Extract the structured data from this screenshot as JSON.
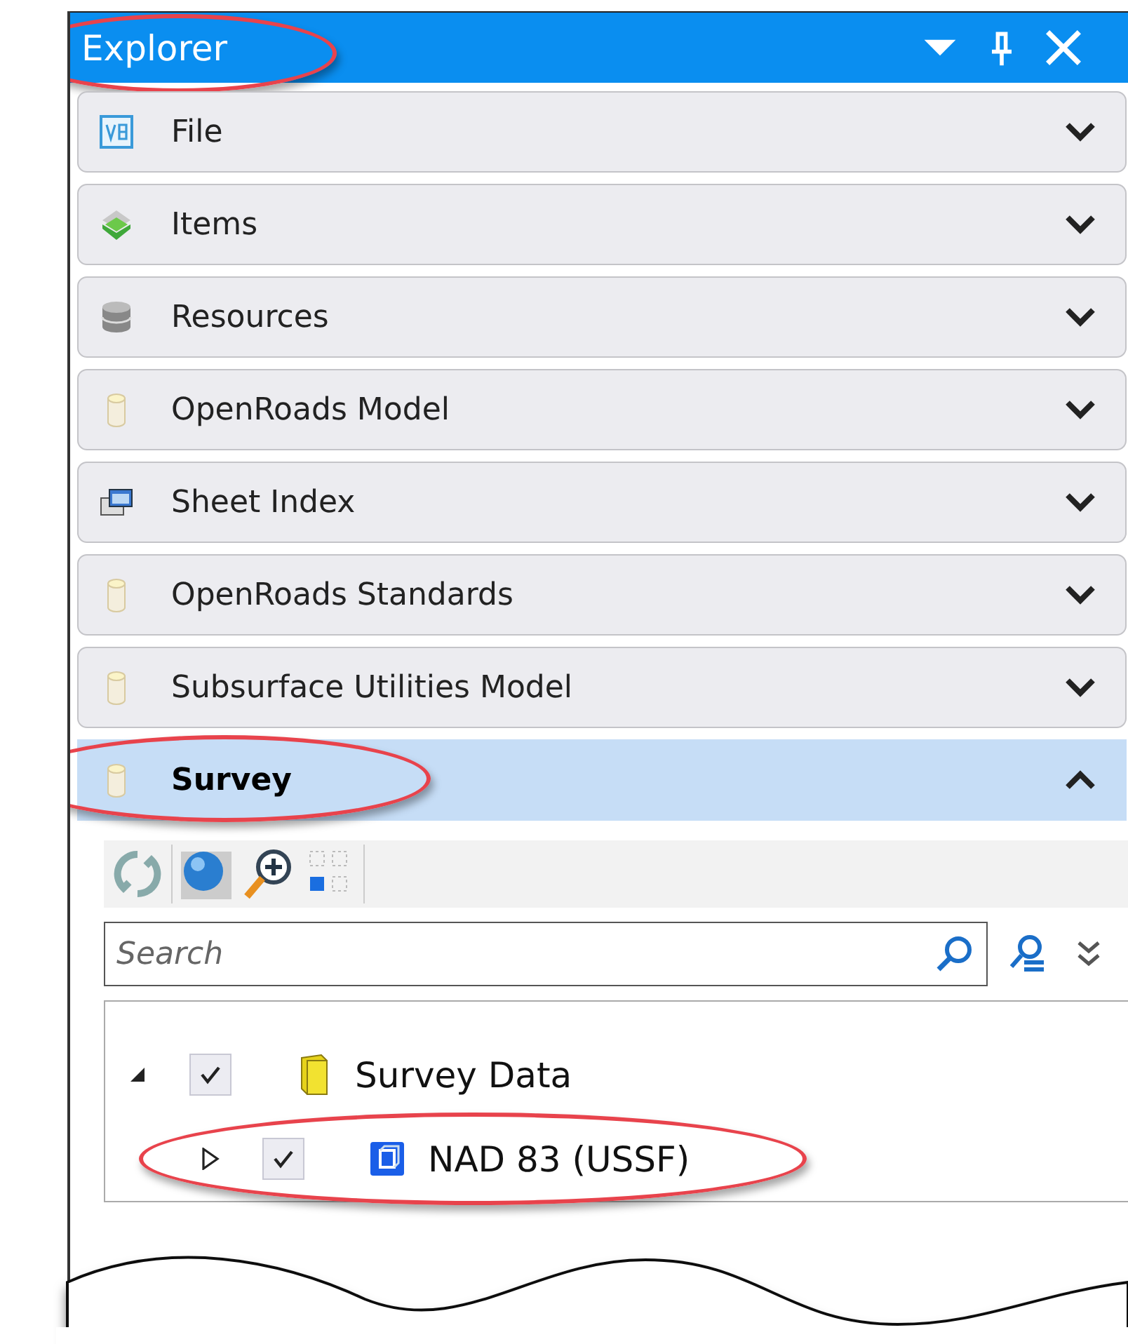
{
  "panel": {
    "title": "Explorer",
    "callout": true
  },
  "sections": [
    {
      "label": "File",
      "kind": "v8",
      "expanded": false,
      "callout": false
    },
    {
      "label": "Items",
      "kind": "layers",
      "expanded": false,
      "callout": false
    },
    {
      "label": "Resources",
      "kind": "database",
      "expanded": false,
      "callout": false
    },
    {
      "label": "OpenRoads Model",
      "kind": "cylinder",
      "expanded": false,
      "callout": false
    },
    {
      "label": "Sheet Index",
      "kind": "sheets",
      "expanded": false,
      "callout": false
    },
    {
      "label": "OpenRoads Standards",
      "kind": "cylinder",
      "expanded": false,
      "callout": false
    },
    {
      "label": "Subsurface Utilities Model",
      "kind": "cylinder",
      "expanded": false,
      "callout": false
    },
    {
      "label": "Survey",
      "kind": "cylinder",
      "expanded": true,
      "callout": true
    }
  ],
  "search": {
    "placeholder": "Search"
  },
  "tree": [
    {
      "label": "Survey Data",
      "kind": "folder",
      "checked": true,
      "expanded": true,
      "callout": false,
      "children": [
        {
          "label": "NAD 83 (USSF)",
          "kind": "cube",
          "checked": true,
          "expanded": false,
          "callout": true
        }
      ]
    }
  ]
}
